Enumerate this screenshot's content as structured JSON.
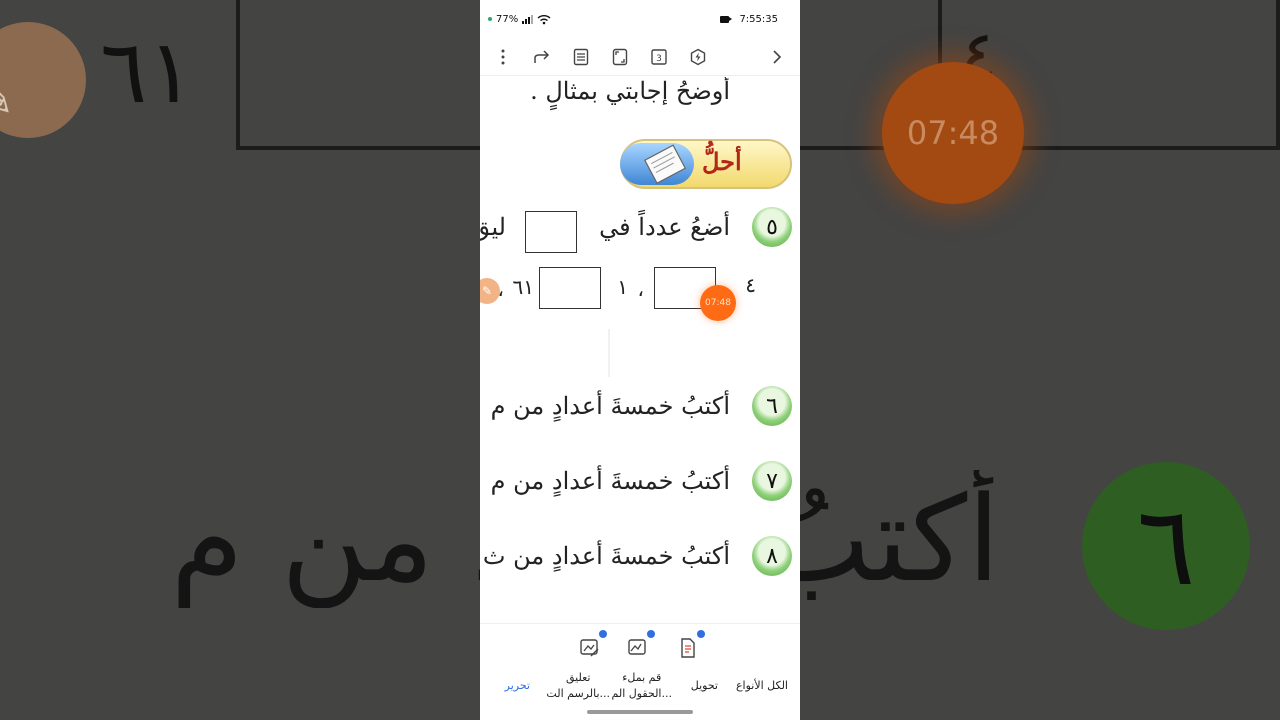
{
  "status_bar": {
    "battery": "77%",
    "time": "7:55:35"
  },
  "toolbar": {
    "icons": [
      "more-vertical-icon",
      "share-icon",
      "read-mode-icon",
      "fullscreen-icon",
      "page-count-icon",
      "ai-tool-icon",
      "next-icon"
    ],
    "page_count": "3"
  },
  "document": {
    "top_line": "أوضحُ إجابتي بمثالٍ .",
    "solve_label": "أحلُّ",
    "q5": {
      "num": "٥",
      "text": "أضعُ عدداً في",
      "text_after": "ليق",
      "seq_1": "٦١",
      "seq_sep1": "،",
      "seq_2": "١",
      "seq_sep2": "،",
      "seq_3": "٤"
    },
    "q6": {
      "num": "٦",
      "text": "أكتبُ خمسةَ أعدادٍ من م"
    },
    "q7": {
      "num": "٧",
      "text": "أكتبُ خمسةَ أعدادٍ من م"
    },
    "q8": {
      "num": "٨",
      "text": "أكتبُ خمسةَ أعدادٍ من ث"
    }
  },
  "overlay": {
    "timer": "07:48"
  },
  "backdrop": {
    "timer": "07:48",
    "num_61": "٦١",
    "num_4": "٤",
    "num_6": "٦",
    "big_text": "أكتبُ أعدادٍ من م"
  },
  "bottom_tabs": [
    {
      "label": "الكل الأنواع"
    },
    {
      "label": "تحويل"
    },
    {
      "label": "قم بملء\nالحقول الم..."
    },
    {
      "label": "تعليق\nبالرسم الت..."
    },
    {
      "label": "تحرير"
    }
  ],
  "colors": {
    "accent": "#2f6fe0",
    "timer": "#ff6a14",
    "badge_green": "#4fa63a"
  }
}
